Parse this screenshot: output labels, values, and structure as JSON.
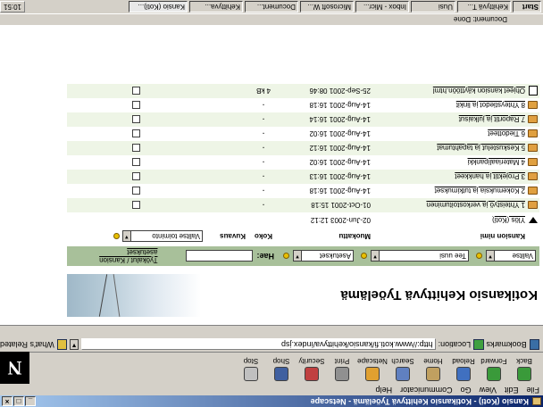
{
  "window": {
    "title": "Kansio (Koti) - Kotikansio Kehittyvä Työelämä - Netscape"
  },
  "menu": [
    "File",
    "Edit",
    "View",
    "Go",
    "Communicator",
    "Help"
  ],
  "toolbar": [
    "Back",
    "Forward",
    "Reload",
    "Home",
    "Search",
    "Netscape",
    "Print",
    "Security",
    "Shop",
    "Stop"
  ],
  "location": {
    "label": "Location:",
    "url": "http://www.koti.fi/kansio/kehittyva/index.jsp",
    "bookmarks": "Bookmarks",
    "related": "What's Related"
  },
  "banner": {
    "title": "Kotikansio Kehittyvä Työelämä"
  },
  "search": {
    "sel1": "Valitse",
    "sel2": "Tee uusi",
    "sel3": "Asetukset",
    "label": "Hae:",
    "link": "Työkalut / Kansion asetukset"
  },
  "header": {
    "name": "Kansion nimi",
    "date": "Muokattu",
    "size": "Koko",
    "type": "Kuvaus",
    "action": "Valitse toiminto"
  },
  "rows": [
    {
      "icon": "arrow",
      "name": "Ylös (Koti)",
      "date": "02-Jun-2003 12:12",
      "size": ""
    },
    {
      "icon": "folder",
      "name": "1 Yhteistyö ja verkostoituminen",
      "date": "01-Oct-2001 15:18",
      "size": "-"
    },
    {
      "icon": "folder",
      "name": "2 Kokemuksia ja tutkimukset",
      "date": "14-Aug-2001 16:18",
      "size": "-"
    },
    {
      "icon": "folder",
      "name": "3 Projektit ja hankkeet",
      "date": "14-Aug-2001 16:13",
      "size": "-"
    },
    {
      "icon": "folder",
      "name": "4 Materiaalipankki",
      "date": "14-Aug-2001 16:02",
      "size": "-"
    },
    {
      "icon": "folder",
      "name": "5 Keskustelut ja tapahtumat",
      "date": "14-Aug-2001 16:12",
      "size": "-"
    },
    {
      "icon": "folder",
      "name": "6 Tiedotteet",
      "date": "14-Aug-2001 16:02",
      "size": "-"
    },
    {
      "icon": "folder",
      "name": "7 Raportit ja julkaisut",
      "date": "14-Aug-2001 16:14",
      "size": "-"
    },
    {
      "icon": "folder",
      "name": "8 Yhteystiedot ja linkit",
      "date": "14-Aug-2001 16:18",
      "size": "-"
    },
    {
      "icon": "doc",
      "name": "Ohjeet kansion käyttöön.html",
      "date": "25-Sep-2001 08:46",
      "size": "4 kB"
    }
  ],
  "status": {
    "text": "Document: Done"
  },
  "taskbar": {
    "start": "Start",
    "items": [
      "Kehittyvä T...",
      "Uusi",
      "Inbox - Micr...",
      "Microsoft W...",
      "Document...",
      "Kehittyva...",
      "Kansio (Koti)..."
    ],
    "clock": "10:51"
  }
}
